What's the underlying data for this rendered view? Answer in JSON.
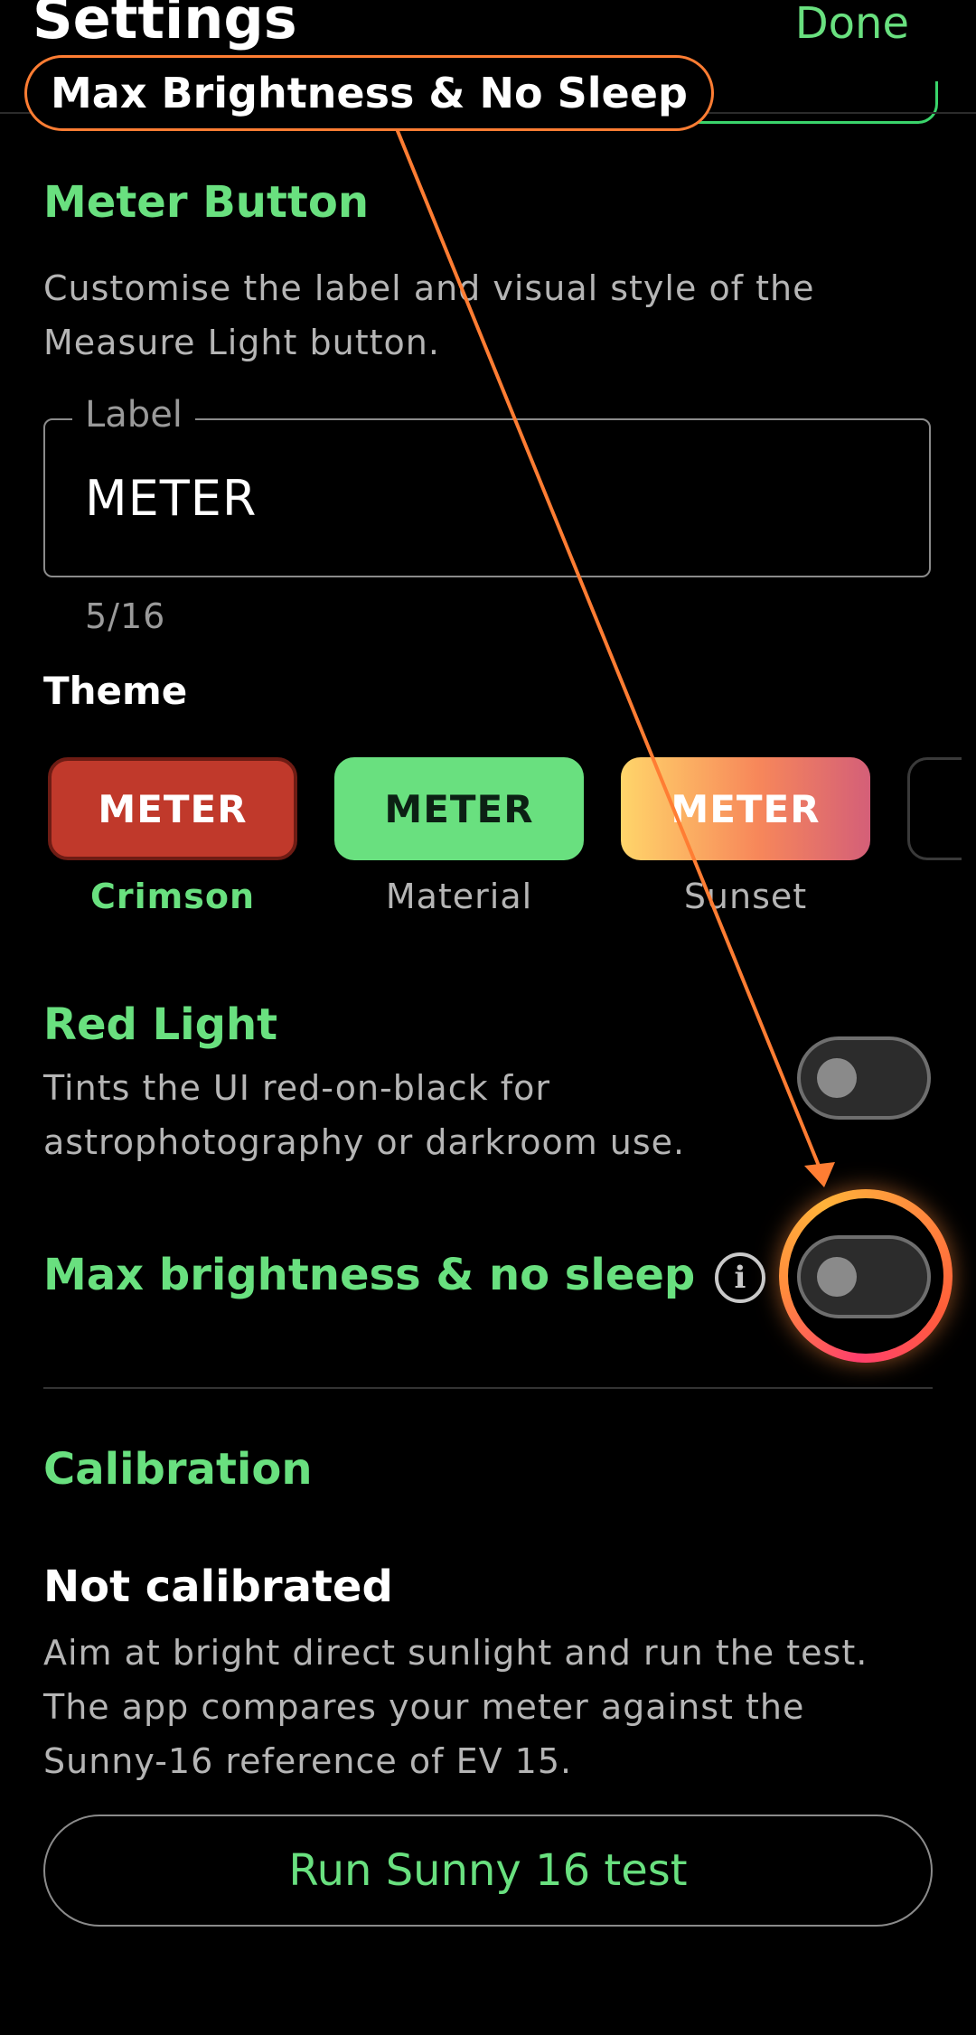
{
  "header": {
    "title": "Settings",
    "done_label": "Done"
  },
  "annotation": {
    "callout": "Max Brightness & No Sleep"
  },
  "meter_button": {
    "heading": "Meter Button",
    "description": "Customise the label and visual style of the Measure Light button.",
    "field": {
      "label": "Label",
      "value": "METER",
      "counter": "5/16"
    },
    "theme_title": "Theme",
    "themes": [
      {
        "button": "METER",
        "name": "Crimson",
        "selected": true
      },
      {
        "button": "METER",
        "name": "Material",
        "selected": false
      },
      {
        "button": "METER",
        "name": "Sunset",
        "selected": false
      }
    ]
  },
  "red_light": {
    "heading": "Red Light",
    "description": "Tints the UI red-on-black for astrophotography or darkroom use.",
    "enabled": false
  },
  "max_brightness": {
    "heading": "Max brightness & no sleep",
    "enabled": false
  },
  "calibration": {
    "heading": "Calibration",
    "status": "Not calibrated",
    "description": "Aim at bright direct sunlight and run the test. The app compares your meter against the Sunny-16 reference of EV 15.",
    "button": "Run Sunny 16 test"
  },
  "colors": {
    "accent": "#69e07f",
    "annotation": "#ff7d33",
    "crimson": "#c0392b",
    "background": "#000000"
  }
}
